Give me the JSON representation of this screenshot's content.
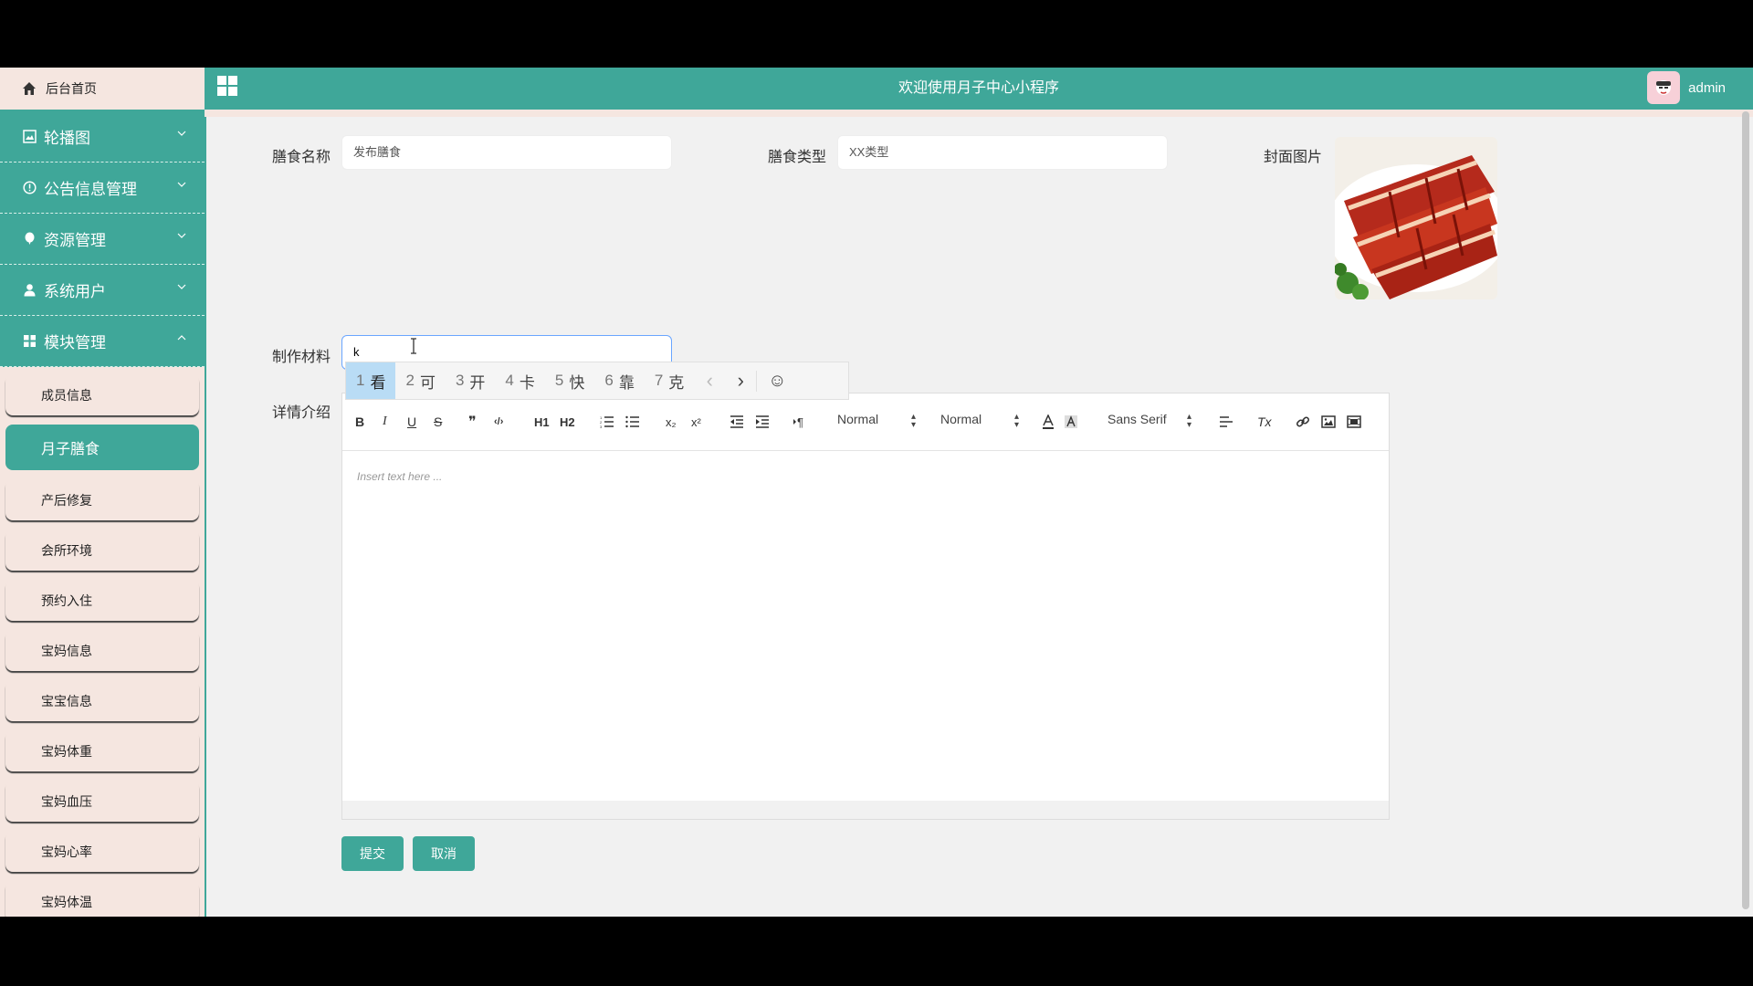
{
  "sidebar": {
    "home": "后台首页",
    "menus": [
      {
        "label": "轮播图",
        "icon": "image-icon"
      },
      {
        "label": "公告信息管理",
        "icon": "info-icon"
      },
      {
        "label": "资源管理",
        "icon": "balloon-icon"
      },
      {
        "label": "系统用户",
        "icon": "user-icon"
      },
      {
        "label": "模块管理",
        "icon": "grid-icon"
      }
    ],
    "submenu": [
      "成员信息",
      "月子膳食",
      "产后修复",
      "会所环境",
      "预约入住",
      "宝妈信息",
      "宝宝信息",
      "宝妈体重",
      "宝妈血压",
      "宝妈心率",
      "宝妈体温"
    ],
    "active": "月子膳食"
  },
  "header": {
    "title": "欢迎使用月子中心小程序",
    "user": "admin"
  },
  "form": {
    "name_label": "膳食名称",
    "name_value": "发布膳食",
    "type_label": "膳食类型",
    "type_value": "XX类型",
    "cover_label": "封面图片",
    "material_label": "制作材料",
    "material_value": "k",
    "detail_label": "详情介绍",
    "editor_placeholder": "Insert text here ..."
  },
  "ime": {
    "candidates": [
      {
        "n": "1",
        "c": "看"
      },
      {
        "n": "2",
        "c": "可"
      },
      {
        "n": "3",
        "c": "开"
      },
      {
        "n": "4",
        "c": "卡"
      },
      {
        "n": "5",
        "c": "快"
      },
      {
        "n": "6",
        "c": "靠"
      },
      {
        "n": "7",
        "c": "克"
      }
    ],
    "prev": "‹",
    "next": "›",
    "emoji": "☺"
  },
  "toolbar": {
    "bold": "B",
    "italic": "I",
    "underline": "U",
    "strike": "S",
    "quote": "❞",
    "code": "‹/›",
    "h1": "H1",
    "h2": "H2",
    "sub": "x₂",
    "sup": "x²",
    "header_select": "Normal",
    "size_select": "Normal",
    "font_select": "Sans Serif",
    "clean": "Tx"
  },
  "buttons": {
    "submit": "提交",
    "cancel": "取消"
  },
  "colors": {
    "accent": "#3fa799",
    "sidebar_bg": "#f5e6e0"
  }
}
